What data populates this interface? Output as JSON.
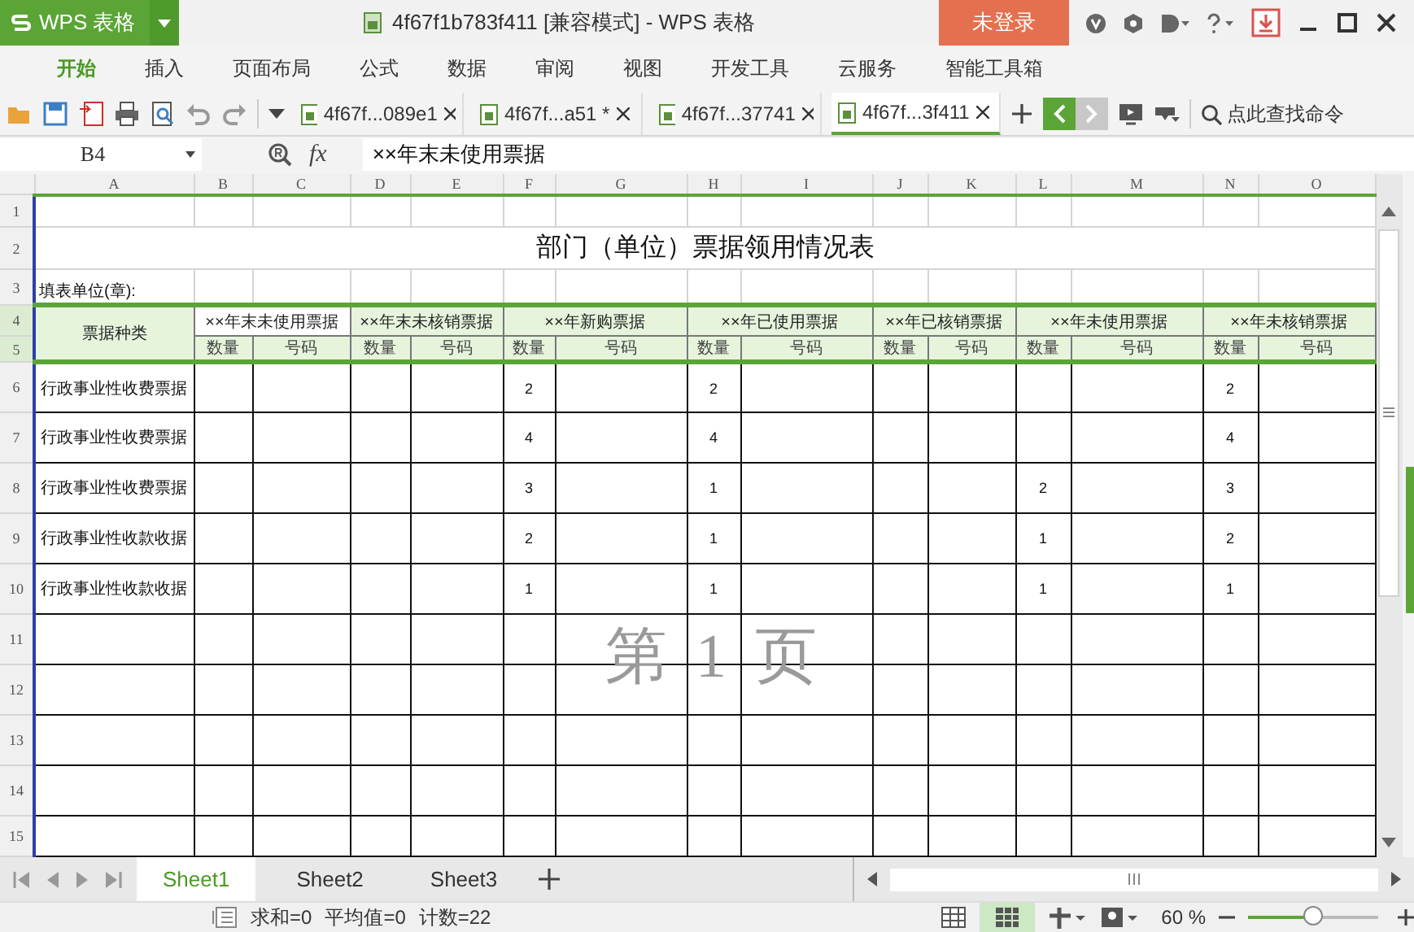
{
  "app_button": {
    "label": "WPS 表格"
  },
  "window": {
    "title": "4f67f1b783f411 [兼容模式] - WPS 表格"
  },
  "login_button": {
    "label": "未登录"
  },
  "menu": [
    {
      "label": "开始",
      "selected": true
    },
    {
      "label": "插入",
      "selected": false
    },
    {
      "label": "页面布局",
      "selected": false
    },
    {
      "label": "公式",
      "selected": false
    },
    {
      "label": "数据",
      "selected": false
    },
    {
      "label": "审阅",
      "selected": false
    },
    {
      "label": "视图",
      "selected": false
    },
    {
      "label": "开发工具",
      "selected": false
    },
    {
      "label": "云服务",
      "selected": false
    },
    {
      "label": "智能工具箱",
      "selected": false
    }
  ],
  "doc_tabs": [
    {
      "label": "4f67f...089e1",
      "selected": false
    },
    {
      "label": "4f67f...a51 *",
      "selected": false
    },
    {
      "label": "4f67f...37741",
      "selected": false
    },
    {
      "label": "4f67f...3f411",
      "selected": true
    }
  ],
  "search_command": {
    "label": "点此查找命令"
  },
  "formula_bar": {
    "cell": "B4",
    "fx_label": "fx",
    "formula": "××年末未使用票据"
  },
  "columns": [
    "A",
    "B",
    "C",
    "D",
    "E",
    "F",
    "G",
    "H",
    "I",
    "J",
    "K",
    "L",
    "M",
    "N",
    "O"
  ],
  "row_numbers": [
    "1",
    "2",
    "3",
    "4",
    "5",
    "6",
    "7",
    "8",
    "9",
    "10",
    "11",
    "12",
    "13",
    "14",
    "15"
  ],
  "sheet": {
    "title": "部门（单位）票据领用情况表",
    "unit_label": "填表单位(章):",
    "category_header": "票据种类",
    "group_headers": [
      "××年末未使用票据",
      "××年末未核销票据",
      "××年新购票据",
      "××年已使用票据",
      "××年已核销票据",
      "××年未使用票据",
      "××年未核销票据"
    ],
    "sub_headers": [
      "数量",
      "号码",
      "数量",
      "号码",
      "数量",
      "号码",
      "数量",
      "号码",
      "数量",
      "号码",
      "数量",
      "号码",
      "数量",
      "号码"
    ],
    "rows": [
      {
        "category": "行政事业性收费票据",
        "cells": [
          null,
          null,
          null,
          null,
          "2",
          null,
          "2",
          null,
          null,
          null,
          null,
          null,
          "2",
          null
        ]
      },
      {
        "category": "行政事业性收费票据",
        "cells": [
          null,
          null,
          null,
          null,
          "4",
          null,
          "4",
          null,
          null,
          null,
          null,
          null,
          "4",
          null
        ]
      },
      {
        "category": "行政事业性收费票据",
        "cells": [
          null,
          null,
          null,
          null,
          "3",
          null,
          "1",
          null,
          null,
          null,
          "2",
          null,
          "3",
          null
        ]
      },
      {
        "category": "行政事业性收款收据",
        "cells": [
          null,
          null,
          null,
          null,
          "2",
          null,
          "1",
          null,
          null,
          null,
          "1",
          null,
          "2",
          null
        ]
      },
      {
        "category": "行政事业性收款收据",
        "cells": [
          null,
          null,
          null,
          null,
          "1",
          null,
          "1",
          null,
          null,
          null,
          "1",
          null,
          "1",
          null
        ]
      }
    ]
  },
  "page_label": "第 1 页",
  "sheet_tabs": [
    {
      "label": "Sheet1",
      "selected": true
    },
    {
      "label": "Sheet2",
      "selected": false
    },
    {
      "label": "Sheet3",
      "selected": false
    }
  ],
  "status": {
    "sum": "求和=0",
    "average": "平均值=0",
    "count": "计数=22",
    "zoom": "60 %",
    "zoom_slider": {
      "level": 0.5
    }
  }
}
